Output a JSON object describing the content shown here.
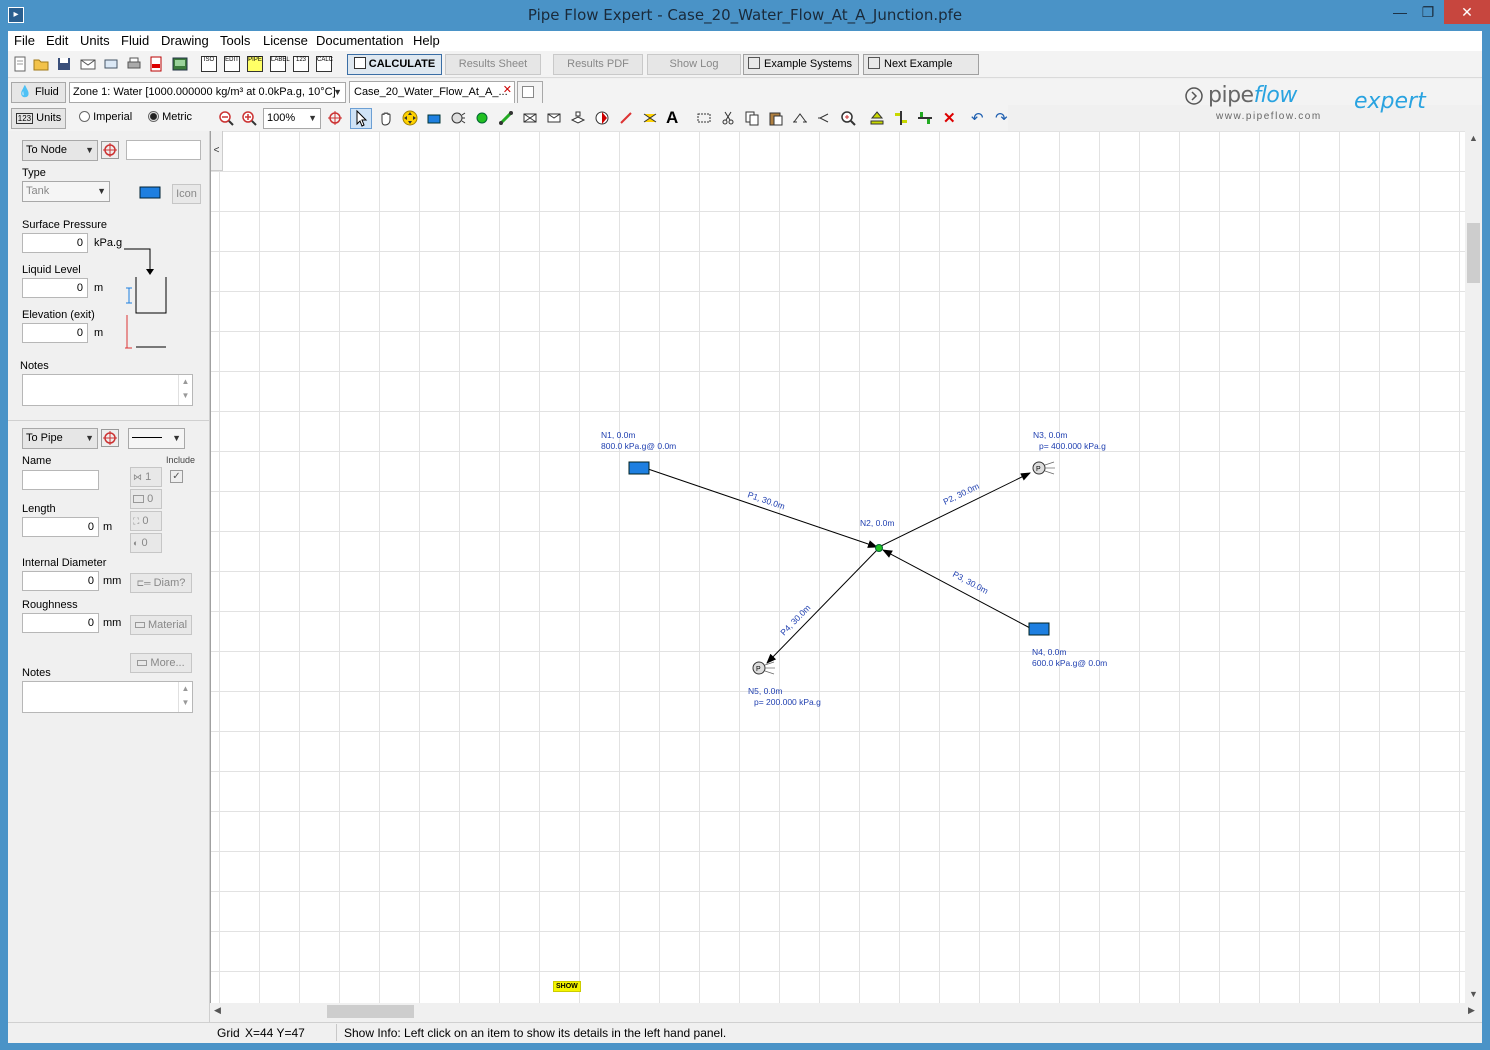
{
  "window": {
    "title": "Pipe Flow Expert - Case_20_Water_Flow_At_A_Junction.pfe"
  },
  "menu": [
    {
      "label": "File"
    },
    {
      "label": "Edit"
    },
    {
      "label": "Units"
    },
    {
      "label": "Fluid"
    },
    {
      "label": "Drawing"
    },
    {
      "label": "Tools"
    },
    {
      "label": "License"
    },
    {
      "label": "Documentation"
    },
    {
      "label": "Help"
    }
  ],
  "toolbar": {
    "calculate": "CALCULATE",
    "results_sheet": "Results Sheet",
    "results_pdf": "Results PDF",
    "show_log": "Show Log",
    "example_systems": "Example Systems",
    "next_example": "Next Example",
    "small_icons": [
      "ISO",
      "EDIT",
      "PIPE",
      "LABEL",
      "123",
      "CALC"
    ]
  },
  "fluid_bar": {
    "fluid_button": "Fluid",
    "zone": "Zone 1: Water [1000.000000 kg/m³ at 0.0kPa.g, 10°C]",
    "tab": "Case_20_Water_Flow_At_A_..."
  },
  "units_bar": {
    "units_button": "Units",
    "imperial": "Imperial",
    "metric": "Metric",
    "zoom": "100%"
  },
  "logo": {
    "brand_a": "pipe",
    "brand_b": "flow",
    "brand_c": "expert",
    "url": "www.pipeflow.com"
  },
  "node_panel": {
    "selector": "To Node",
    "type_label": "Type",
    "type_value": "Tank",
    "icon_button": "Icon",
    "surface_pressure_label": "Surface Pressure",
    "surface_pressure_value": "0",
    "surface_pressure_unit": "kPa.g",
    "liquid_level_label": "Liquid Level",
    "liquid_level_value": "0",
    "liquid_level_unit": "m",
    "elevation_label": "Elevation (exit)",
    "elevation_value": "0",
    "elevation_unit": "m",
    "notes_label": "Notes"
  },
  "pipe_panel": {
    "selector": "To Pipe",
    "name_label": "Name",
    "include_label": "Include",
    "length_label": "Length",
    "length_value": "0",
    "length_unit": "m",
    "diameter_label": "Internal Diameter",
    "diameter_value": "0",
    "diameter_unit": "mm",
    "diam_button": "Diam?",
    "roughness_label": "Roughness",
    "roughness_value": "0",
    "roughness_unit": "mm",
    "material_button": "Material",
    "more_button": "More...",
    "notes_label": "Notes",
    "counts": [
      "1",
      "0",
      "0",
      "0"
    ]
  },
  "diagram": {
    "nodes": [
      {
        "id": "N1",
        "line1": "N1, 0.0m",
        "line2": "800.0 kPa.g@ 0.0m",
        "kind": "tank"
      },
      {
        "id": "N2",
        "line1": "N2, 0.0m",
        "kind": "junction"
      },
      {
        "id": "N3",
        "line1": "N3, 0.0m",
        "line2": "p= 400.000 kPa.g",
        "kind": "end-pressure"
      },
      {
        "id": "N4",
        "line1": "N4, 0.0m",
        "line2": "600.0 kPa.g@ 0.0m",
        "kind": "tank"
      },
      {
        "id": "N5",
        "line1": "N5, 0.0m",
        "line2": "p= 200.000 kPa.g",
        "kind": "end-pressure"
      }
    ],
    "pipes": [
      {
        "label": "P1, 30.0m"
      },
      {
        "label": "P2, 30.0m"
      },
      {
        "label": "P3, 30.0m"
      },
      {
        "label": "P4, 30.0m"
      }
    ],
    "show_badge": "SHOW"
  },
  "status": {
    "grid": "Grid",
    "coords": "X=44  Y=47",
    "info": "Show Info: Left click on an item to show its details in the left hand panel."
  },
  "colors": {
    "titlebar": "#4a93c7",
    "tank_fill": "#1e7fe0",
    "diagram_text": "#1f3fb0",
    "junction": "#22c022"
  }
}
